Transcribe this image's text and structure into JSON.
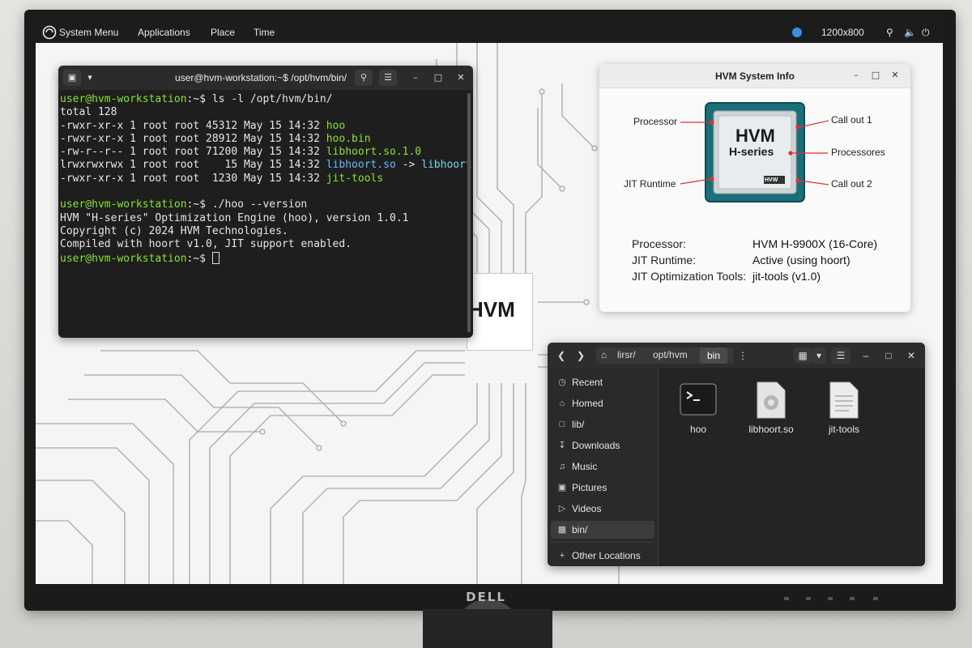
{
  "monitor": {
    "brand": "DELL"
  },
  "topbar": {
    "menu": [
      "System Menu",
      "Applications",
      "Place",
      "Time"
    ],
    "resolution": "1200x800"
  },
  "wallpaper": {
    "logo_text": "HVM"
  },
  "terminal": {
    "title": "user@hvm-workstation:~$ /opt/hvm/bin/",
    "prompt": "user@hvm-workstation",
    "lines": [
      {
        "prompt_path": ":~$ ",
        "cmd": "ls -l /opt/hvm/bin/"
      },
      {
        "text": "total 128"
      },
      {
        "text": "-rwxr-xr-x 1 root root 45312 May 15 14:32 ",
        "name": "hoo",
        "color": "green"
      },
      {
        "text": "-rwxr-xr-x 1 root root 28912 May 15 14:32 ",
        "name": "hoo.bin",
        "color": "green"
      },
      {
        "text": "-rw-r--r-- 1 root root 71200 May 15 14:32 ",
        "name": "libhoort.so.1.0",
        "color": "green"
      },
      {
        "text": "lrwxrwxrwx 1 root root    15 May 15 14:32 ",
        "name": "libhoort.so",
        "arrow": " -> ",
        "target": "libhoort",
        "color": "blue"
      },
      {
        "text": "-rwxr-xr-x 1 root root  1230 May 15 14:32 ",
        "name": "jit-tools",
        "color": "green"
      },
      {
        "text": ""
      },
      {
        "prompt_path": ":~$ ",
        "cmd": "./hoo --version"
      },
      {
        "text": "HVM \"H-series\" Optimization Engine (hoo), version 1.0.1"
      },
      {
        "text": "Copyright (c) 2024 HVM Technologies."
      },
      {
        "text": "Compiled with hoort v1.0, JIT support enabled."
      },
      {
        "prompt_path": ":~$ ",
        "cmd": ""
      }
    ]
  },
  "info_window": {
    "title": "HVM System Info",
    "chip": {
      "brand": "HVM",
      "series": "H-series",
      "badge": "HVW"
    },
    "callouts": [
      "Processor",
      "Call out 1",
      "Processores",
      "JIT Runtime",
      "Call out 2"
    ],
    "rows": [
      {
        "key": "Processor:",
        "value": "HVM H-9900X (16-Core)"
      },
      {
        "key": "JIT Runtime:",
        "value": "Active (using hoort)"
      },
      {
        "key": "JIT Optimization Tools:",
        "value": "jit-tools (v1.0)"
      }
    ]
  },
  "file_manager": {
    "breadcrumbs": [
      "lirsr/",
      "opt/hvm",
      "bin"
    ],
    "sidebar": [
      {
        "label": "Recent",
        "icon": "clock-icon"
      },
      {
        "label": "Homed",
        "icon": "home-icon"
      },
      {
        "label": "lib/",
        "icon": "folder-icon"
      },
      {
        "label": "Downloads",
        "icon": "download-icon"
      },
      {
        "label": "Music",
        "icon": "music-icon"
      },
      {
        "label": "Pictures",
        "icon": "picture-icon"
      },
      {
        "label": "Videos",
        "icon": "video-icon"
      },
      {
        "label": "bin/",
        "icon": "trash-icon"
      }
    ],
    "other_locations": "Other Locations",
    "files": [
      {
        "name": "hoo",
        "icon": "terminal-file-icon"
      },
      {
        "name": "libhoort.so",
        "icon": "library-file-icon"
      },
      {
        "name": "jit-tools",
        "icon": "text-file-icon"
      }
    ]
  }
}
